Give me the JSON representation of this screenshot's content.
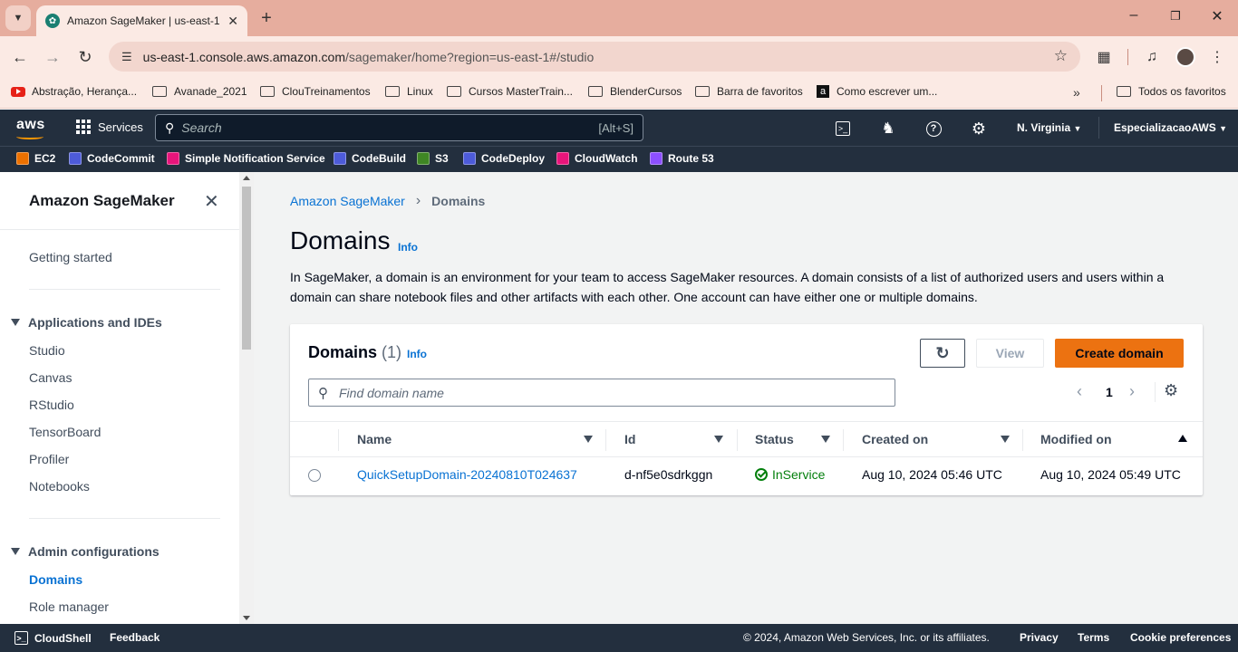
{
  "browser": {
    "tab_title": "Amazon SageMaker | us-east-1",
    "url_host": "us-east-1.console.aws.amazon.com",
    "url_path": "/sagemaker/home?region=us-east-1#/studio",
    "bookmarks": [
      "Abstração, Herança...",
      "Avanade_2021",
      "ClouTreinamentos",
      "Linux",
      "Cursos MasterTrain...",
      "BlenderCursos",
      "Barra de favoritos",
      "Como escrever um..."
    ],
    "all_bookmarks": "Todos os favoritos",
    "colors": {
      "frame": "#e6ad9e",
      "toolbar": "#fbeae4"
    }
  },
  "aws_nav": {
    "logo": "aws",
    "services": "Services",
    "search_placeholder": "Search",
    "search_shortcut": "[Alt+S]",
    "region": "N. Virginia",
    "account": "EspecializacaoAWS",
    "favorites": [
      {
        "label": "EC2",
        "color": "#ed7100"
      },
      {
        "label": "CodeCommit",
        "color": "#4d5bd9"
      },
      {
        "label": "Simple Notification Service",
        "color": "#e7157b"
      },
      {
        "label": "CodeBuild",
        "color": "#4d5bd9"
      },
      {
        "label": "S3",
        "color": "#3f8624"
      },
      {
        "label": "CodeDeploy",
        "color": "#4d5bd9"
      },
      {
        "label": "CloudWatch",
        "color": "#e7157b"
      },
      {
        "label": "Route 53",
        "color": "#8c4fff"
      }
    ]
  },
  "sidenav": {
    "title": "Amazon SageMaker",
    "getting_started": "Getting started",
    "section_apps": "Applications and IDEs",
    "apps": [
      "Studio",
      "Canvas",
      "RStudio",
      "TensorBoard",
      "Profiler",
      "Notebooks"
    ],
    "section_admin": "Admin configurations",
    "admin": [
      "Domains",
      "Role manager"
    ]
  },
  "main": {
    "breadcrumb_root": "Amazon SageMaker",
    "breadcrumb_current": "Domains",
    "title": "Domains",
    "info": "Info",
    "description": "In SageMaker, a domain is an environment for your team to access SageMaker resources. A domain consists of a list of authorized users and users within a domain can share notebook files and other artifacts with each other. One account can have either one or multiple domains.",
    "container": {
      "title": "Domains",
      "count": "(1)",
      "info": "Info",
      "view_label": "View",
      "create_label": "Create domain",
      "filter_placeholder": "Find domain name",
      "page": "1",
      "columns": [
        "Name",
        "Id",
        "Status",
        "Created on",
        "Modified on"
      ],
      "rows": [
        {
          "name": "QuickSetupDomain-20240810T024637",
          "id": "d-nf5e0sdrkggn",
          "status": "InService",
          "created": "Aug 10, 2024 05:46 UTC",
          "modified": "Aug 10, 2024 05:49 UTC"
        }
      ]
    },
    "colors": {
      "link": "#0972d3",
      "primary": "#ec7211",
      "success": "#037f0c"
    }
  },
  "footer": {
    "cloudshell": "CloudShell",
    "feedback": "Feedback",
    "copyright": "© 2024, Amazon Web Services, Inc. or its affiliates.",
    "privacy": "Privacy",
    "terms": "Terms",
    "cookies": "Cookie preferences"
  }
}
